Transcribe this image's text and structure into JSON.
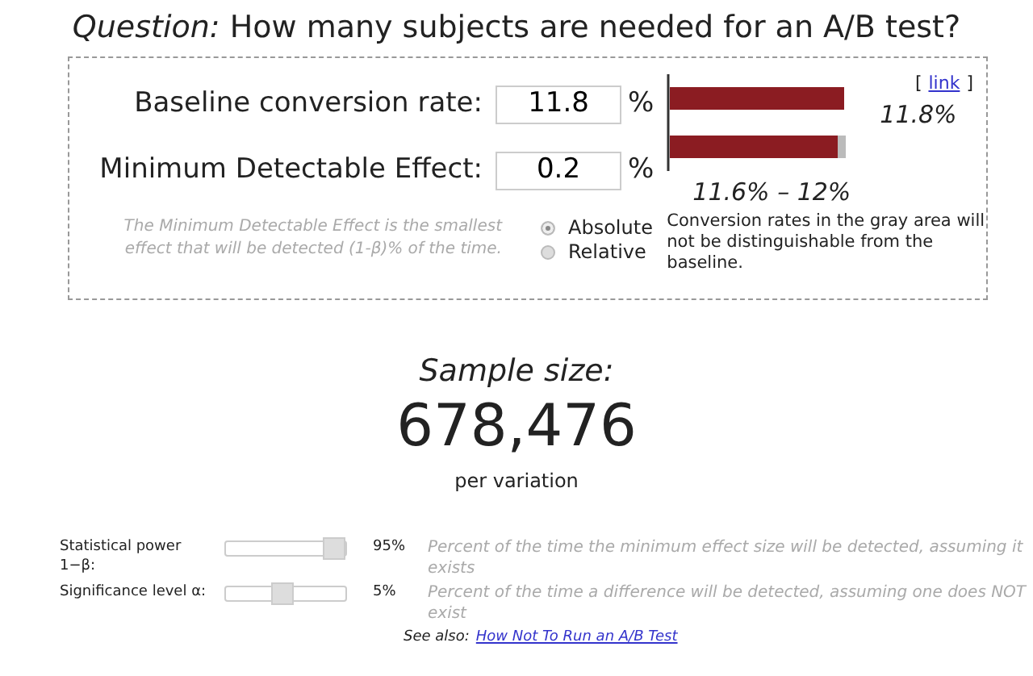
{
  "question": "*Question:* How many subjects are needed for an A/B test?",
  "inputs": [
    {
      "label": "Baseline conversion rate:",
      "value": "11.8",
      "unit": "%"
    },
    {
      "label": "Minimum Detectable Effect:",
      "value": "0.2",
      "unit": "%"
    }
  ],
  "mde_hint": "The Minimum Detectable Effect is the smallest effect that will be detected (1-β)% of the time.",
  "mde_modes": [
    {
      "label": "Absolute",
      "selected": true
    },
    {
      "label": "Relative",
      "selected": false
    }
  ],
  "link": {
    "open": "[",
    "label": "link",
    "close": "]"
  },
  "chart_labels": {
    "baseline": "11.8%",
    "range": "11.6% – 12%"
  },
  "chart_note": "Conversion rates in the gray area will not be distinguishable from the baseline.",
  "result": {
    "title": "Sample size:",
    "value": "678,476",
    "unit": "per variation"
  },
  "sliders": [
    {
      "label": "Statistical power 1−β:",
      "level": 0.97,
      "reading": "95%",
      "hint": "Percent of the time the minimum effect size will be detected, assuming it exists"
    },
    {
      "label": "Significance level α:",
      "level": 0.45,
      "reading": "5%",
      "hint": "Percent of the time a difference will be detected, assuming one does NOT exist"
    }
  ],
  "see_also": {
    "label": "See also:",
    "link": "How Not To Run an A/B Test"
  }
}
